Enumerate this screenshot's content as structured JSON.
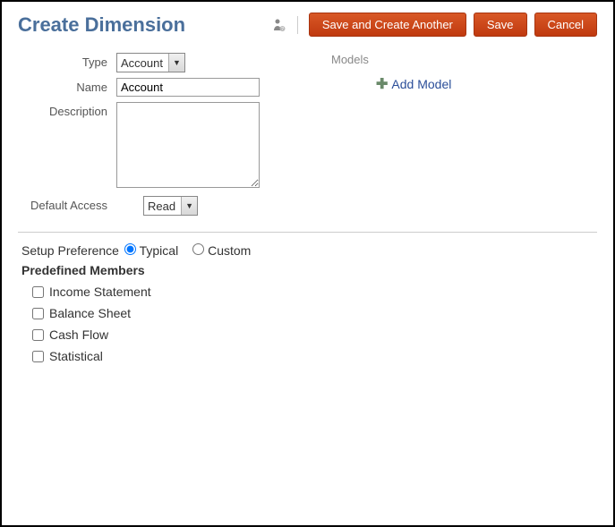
{
  "header": {
    "title": "Create Dimension",
    "buttons": {
      "save_another": "Save and Create Another",
      "save": "Save",
      "cancel": "Cancel"
    }
  },
  "form": {
    "type_label": "Type",
    "type_value": "Account",
    "name_label": "Name",
    "name_value": "Account",
    "description_label": "Description",
    "description_value": "",
    "default_access_label": "Default Access",
    "default_access_value": "Read"
  },
  "models": {
    "title": "Models",
    "add_label": "Add Model"
  },
  "setup": {
    "label": "Setup Preference",
    "option_typical": "Typical",
    "option_custom": "Custom",
    "selected": "typical"
  },
  "predefined": {
    "title": "Predefined Members",
    "items": [
      "Income Statement",
      "Balance Sheet",
      "Cash Flow",
      "Statistical"
    ]
  }
}
